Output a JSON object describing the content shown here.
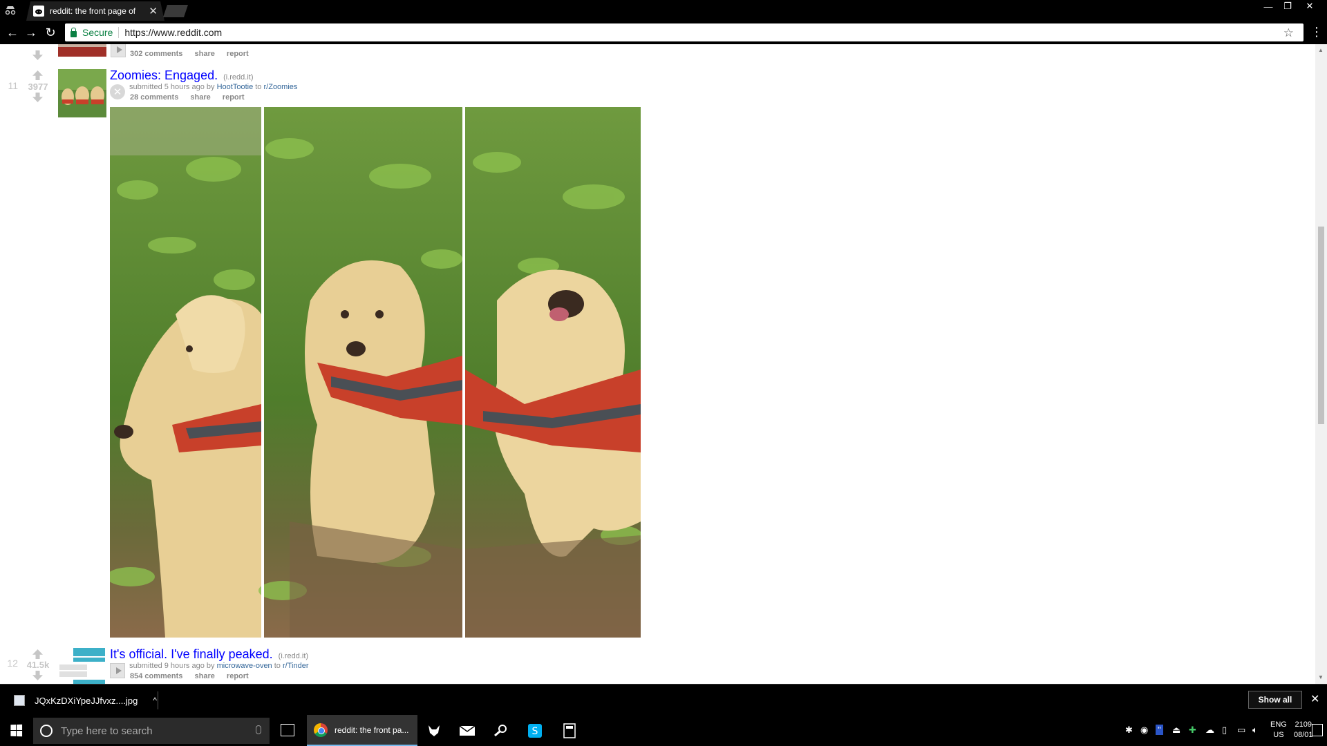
{
  "browser": {
    "tab_title": "reddit: the front page of",
    "tab_close": "✕",
    "secure_label": "Secure",
    "url": "https://www.reddit.com",
    "star": "☆",
    "menu": "⋮",
    "back": "←",
    "forward": "→",
    "reload": "↻",
    "minimize": "—",
    "maximize": "❐",
    "close": "✕"
  },
  "prev_post": {
    "buttons": {
      "comments": "302 comments",
      "share": "share",
      "report": "report"
    }
  },
  "post_11": {
    "rank": "11",
    "score": "3977",
    "title": "Zoomies: Engaged.",
    "domain": "(i.redd.it)",
    "tagline": {
      "submitted": "submitted 5 hours ago by",
      "author": "HootTootie",
      "to": "to",
      "subreddit": "r/Zoomies"
    },
    "buttons": {
      "comments": "28 comments",
      "share": "share",
      "report": "report"
    },
    "expando_close": "✕"
  },
  "post_12": {
    "rank": "12",
    "score": "41.5k",
    "title": "It's official. I've finally peaked.",
    "domain": "(i.redd.it)",
    "tagline": {
      "submitted": "submitted 9 hours ago by",
      "author": "microwave-oven",
      "to": "to",
      "subreddit": "r/Tinder"
    },
    "buttons": {
      "comments": "854 comments",
      "share": "share",
      "report": "report"
    }
  },
  "downloads": {
    "file_name": "JQxKzDXiYpeJJfvxz....jpg",
    "caret": "^",
    "show_all": "Show all",
    "close": "✕"
  },
  "taskbar": {
    "search_placeholder": "Type here to search",
    "chrome_app_label": "reddit: the front pa...",
    "lang_top": "ENG",
    "lang_bottom": "US",
    "time": "2109",
    "date": "08/01"
  },
  "icons": {
    "incognito": "incognito-icon",
    "secure": "lock-icon",
    "star": "star-icon",
    "upvote": "arrow-up-icon",
    "downvote": "arrow-down-icon",
    "expando_close": "close-circle-icon",
    "play": "play-icon"
  },
  "colors": {
    "link": "#0000ff",
    "tagline_link": "#336699",
    "secure_green": "#0b8043",
    "vote_gray": "#c6c6c6"
  }
}
